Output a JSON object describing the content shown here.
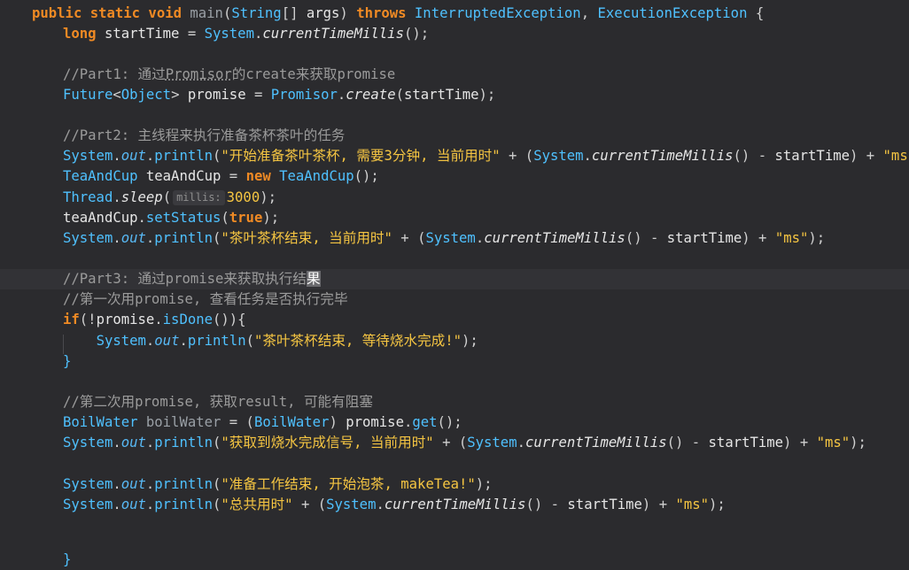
{
  "editor": {
    "language": "Java",
    "lines": [
      {
        "tokens": [
          {
            "t": "public static void ",
            "c": "t-kw"
          },
          {
            "t": "main",
            "c": "t-dim"
          },
          {
            "t": "(",
            "c": "t-punct"
          },
          {
            "t": "String",
            "c": "t-type"
          },
          {
            "t": "[] ",
            "c": "t-punct"
          },
          {
            "t": "args",
            "c": "t-var"
          },
          {
            "t": ") ",
            "c": "t-punct"
          },
          {
            "t": "throws ",
            "c": "t-kw"
          },
          {
            "t": "InterruptedException",
            "c": "t-type"
          },
          {
            "t": ", ",
            "c": "t-punct"
          },
          {
            "t": "ExecutionException",
            "c": "t-type"
          },
          {
            "t": " {",
            "c": "t-punct"
          }
        ]
      },
      {
        "tokens": [
          {
            "t": "long ",
            "c": "t-kw"
          },
          {
            "t": "startTime",
            "c": "t-var"
          },
          {
            "t": " = ",
            "c": "t-punct"
          },
          {
            "t": "System",
            "c": "t-type"
          },
          {
            "t": ".",
            "c": "t-punct"
          },
          {
            "t": "currentTimeMillis",
            "c": "t-mstatic"
          },
          {
            "t": "();",
            "c": "t-punct"
          }
        ]
      },
      {
        "tokens": []
      },
      {
        "tokens": [
          {
            "t": "//Part1: 通过",
            "c": "t-cmt"
          },
          {
            "t": "Promisor",
            "c": "t-cmt t-underline"
          },
          {
            "t": "的create来获取promise",
            "c": "t-cmt"
          }
        ]
      },
      {
        "tokens": [
          {
            "t": "Future",
            "c": "t-type"
          },
          {
            "t": "<",
            "c": "t-punct"
          },
          {
            "t": "Object",
            "c": "t-type"
          },
          {
            "t": "> ",
            "c": "t-punct"
          },
          {
            "t": "promise",
            "c": "t-var"
          },
          {
            "t": " = ",
            "c": "t-punct"
          },
          {
            "t": "Promisor",
            "c": "t-type"
          },
          {
            "t": ".",
            "c": "t-punct"
          },
          {
            "t": "create",
            "c": "t-mstatic"
          },
          {
            "t": "(",
            "c": "t-punct"
          },
          {
            "t": "startTime",
            "c": "t-var"
          },
          {
            "t": ");",
            "c": "t-punct"
          }
        ]
      },
      {
        "tokens": []
      },
      {
        "tokens": [
          {
            "t": "//Part2: 主线程来执行准备茶杯茶叶的任务",
            "c": "t-cmt"
          }
        ]
      },
      {
        "tokens": [
          {
            "t": "System",
            "c": "t-type"
          },
          {
            "t": ".",
            "c": "t-punct"
          },
          {
            "t": "out",
            "c": "t-field"
          },
          {
            "t": ".",
            "c": "t-punct"
          },
          {
            "t": "println",
            "c": "t-method"
          },
          {
            "t": "(",
            "c": "t-punct"
          },
          {
            "t": "\"开始准备茶叶茶杯, 需要3分钟, 当前用时\"",
            "c": "t-str"
          },
          {
            "t": " + (",
            "c": "t-punct"
          },
          {
            "t": "System",
            "c": "t-type"
          },
          {
            "t": ".",
            "c": "t-punct"
          },
          {
            "t": "currentTimeMillis",
            "c": "t-mstatic"
          },
          {
            "t": "() - ",
            "c": "t-punct"
          },
          {
            "t": "startTime",
            "c": "t-var"
          },
          {
            "t": ") + ",
            "c": "t-punct"
          },
          {
            "t": "\"ms\"",
            "c": "t-str"
          },
          {
            "t": ");",
            "c": "t-punct"
          }
        ]
      },
      {
        "tokens": [
          {
            "t": "TeaAndCup ",
            "c": "t-type"
          },
          {
            "t": "teaAndCup",
            "c": "t-var"
          },
          {
            "t": " = ",
            "c": "t-punct"
          },
          {
            "t": "new ",
            "c": "t-kw"
          },
          {
            "t": "TeaAndCup",
            "c": "t-type"
          },
          {
            "t": "();",
            "c": "t-punct"
          }
        ]
      },
      {
        "tokens": [
          {
            "t": "Thread",
            "c": "t-type"
          },
          {
            "t": ".",
            "c": "t-punct"
          },
          {
            "t": "sleep",
            "c": "t-mstatic"
          },
          {
            "t": "(",
            "c": "t-punct"
          },
          {
            "t": "millis:",
            "c": "hint"
          },
          {
            "t": "3000",
            "c": "t-num"
          },
          {
            "t": ");",
            "c": "t-punct"
          }
        ]
      },
      {
        "tokens": [
          {
            "t": "teaAndCup",
            "c": "t-var"
          },
          {
            "t": ".",
            "c": "t-punct"
          },
          {
            "t": "setStatus",
            "c": "t-method"
          },
          {
            "t": "(",
            "c": "t-punct"
          },
          {
            "t": "true",
            "c": "t-kw"
          },
          {
            "t": ");",
            "c": "t-punct"
          }
        ]
      },
      {
        "tokens": [
          {
            "t": "System",
            "c": "t-type"
          },
          {
            "t": ".",
            "c": "t-punct"
          },
          {
            "t": "out",
            "c": "t-field"
          },
          {
            "t": ".",
            "c": "t-punct"
          },
          {
            "t": "println",
            "c": "t-method"
          },
          {
            "t": "(",
            "c": "t-punct"
          },
          {
            "t": "\"茶叶茶杯结束, 当前用时\"",
            "c": "t-str"
          },
          {
            "t": " + (",
            "c": "t-punct"
          },
          {
            "t": "System",
            "c": "t-type"
          },
          {
            "t": ".",
            "c": "t-punct"
          },
          {
            "t": "currentTimeMillis",
            "c": "t-mstatic"
          },
          {
            "t": "() - ",
            "c": "t-punct"
          },
          {
            "t": "startTime",
            "c": "t-var"
          },
          {
            "t": ") + ",
            "c": "t-punct"
          },
          {
            "t": "\"ms\"",
            "c": "t-str"
          },
          {
            "t": ");",
            "c": "t-punct"
          }
        ]
      },
      {
        "tokens": []
      },
      {
        "current": true,
        "tokens": [
          {
            "t": "//Part3: 通过promise来获取执行结",
            "c": "t-cmt"
          },
          {
            "t": "果",
            "c": "t-cmt caret-block"
          }
        ]
      },
      {
        "tokens": [
          {
            "t": "//第一次用promise, 查看任务是否执行完毕",
            "c": "t-cmt"
          }
        ]
      },
      {
        "tokens": [
          {
            "t": "if",
            "c": "t-kw"
          },
          {
            "t": "(!",
            "c": "t-punct"
          },
          {
            "t": "promise",
            "c": "t-var"
          },
          {
            "t": ".",
            "c": "t-punct"
          },
          {
            "t": "isDone",
            "c": "t-method"
          },
          {
            "t": "()){",
            "c": "t-punct"
          }
        ]
      },
      {
        "tokens": [
          {
            "t": "    ",
            "c": "t-punct"
          },
          {
            "t": "System",
            "c": "t-type"
          },
          {
            "t": ".",
            "c": "t-punct"
          },
          {
            "t": "out",
            "c": "t-field"
          },
          {
            "t": ".",
            "c": "t-punct"
          },
          {
            "t": "println",
            "c": "t-method"
          },
          {
            "t": "(",
            "c": "t-punct"
          },
          {
            "t": "\"茶叶茶杯结束, 等待烧水完成!\"",
            "c": "t-str"
          },
          {
            "t": ");",
            "c": "t-punct"
          }
        ]
      },
      {
        "tokens": [
          {
            "t": "}",
            "c": "t-type"
          }
        ]
      },
      {
        "tokens": []
      },
      {
        "tokens": [
          {
            "t": "//第二次用promise, 获取result, 可能有阻塞",
            "c": "t-cmt"
          }
        ]
      },
      {
        "tokens": [
          {
            "t": "BoilWater ",
            "c": "t-type"
          },
          {
            "t": "boilWater",
            "c": "t-dim"
          },
          {
            "t": " = (",
            "c": "t-punct"
          },
          {
            "t": "BoilWater",
            "c": "t-type"
          },
          {
            "t": ") ",
            "c": "t-punct"
          },
          {
            "t": "promise",
            "c": "t-var"
          },
          {
            "t": ".",
            "c": "t-punct"
          },
          {
            "t": "get",
            "c": "t-method"
          },
          {
            "t": "();",
            "c": "t-punct"
          }
        ]
      },
      {
        "tokens": [
          {
            "t": "System",
            "c": "t-type"
          },
          {
            "t": ".",
            "c": "t-punct"
          },
          {
            "t": "out",
            "c": "t-field"
          },
          {
            "t": ".",
            "c": "t-punct"
          },
          {
            "t": "println",
            "c": "t-method"
          },
          {
            "t": "(",
            "c": "t-punct"
          },
          {
            "t": "\"获取到烧水完成信号, 当前用时\"",
            "c": "t-str"
          },
          {
            "t": " + (",
            "c": "t-punct"
          },
          {
            "t": "System",
            "c": "t-type"
          },
          {
            "t": ".",
            "c": "t-punct"
          },
          {
            "t": "currentTimeMillis",
            "c": "t-mstatic"
          },
          {
            "t": "() - ",
            "c": "t-punct"
          },
          {
            "t": "startTime",
            "c": "t-var"
          },
          {
            "t": ") + ",
            "c": "t-punct"
          },
          {
            "t": "\"ms\"",
            "c": "t-str"
          },
          {
            "t": ");",
            "c": "t-punct"
          }
        ]
      },
      {
        "tokens": []
      },
      {
        "tokens": [
          {
            "t": "System",
            "c": "t-type"
          },
          {
            "t": ".",
            "c": "t-punct"
          },
          {
            "t": "out",
            "c": "t-field"
          },
          {
            "t": ".",
            "c": "t-punct"
          },
          {
            "t": "println",
            "c": "t-method"
          },
          {
            "t": "(",
            "c": "t-punct"
          },
          {
            "t": "\"准备工作结束, 开始泡茶, makeTea!\"",
            "c": "t-str"
          },
          {
            "t": ");",
            "c": "t-punct"
          }
        ]
      },
      {
        "tokens": [
          {
            "t": "System",
            "c": "t-type"
          },
          {
            "t": ".",
            "c": "t-punct"
          },
          {
            "t": "out",
            "c": "t-field"
          },
          {
            "t": ".",
            "c": "t-punct"
          },
          {
            "t": "println",
            "c": "t-method"
          },
          {
            "t": "(",
            "c": "t-punct"
          },
          {
            "t": "\"总共用时\"",
            "c": "t-str"
          },
          {
            "t": " + (",
            "c": "t-punct"
          },
          {
            "t": "System",
            "c": "t-type"
          },
          {
            "t": ".",
            "c": "t-punct"
          },
          {
            "t": "currentTimeMillis",
            "c": "t-mstatic"
          },
          {
            "t": "() - ",
            "c": "t-punct"
          },
          {
            "t": "startTime",
            "c": "t-var"
          },
          {
            "t": ") + ",
            "c": "t-punct"
          },
          {
            "t": "\"ms\"",
            "c": "t-str"
          },
          {
            "t": ");",
            "c": "t-punct"
          }
        ]
      },
      {
        "tokens": []
      },
      {
        "tokens": []
      },
      {
        "tokens": [
          {
            "t": "}",
            "c": "t-type"
          }
        ]
      }
    ]
  }
}
